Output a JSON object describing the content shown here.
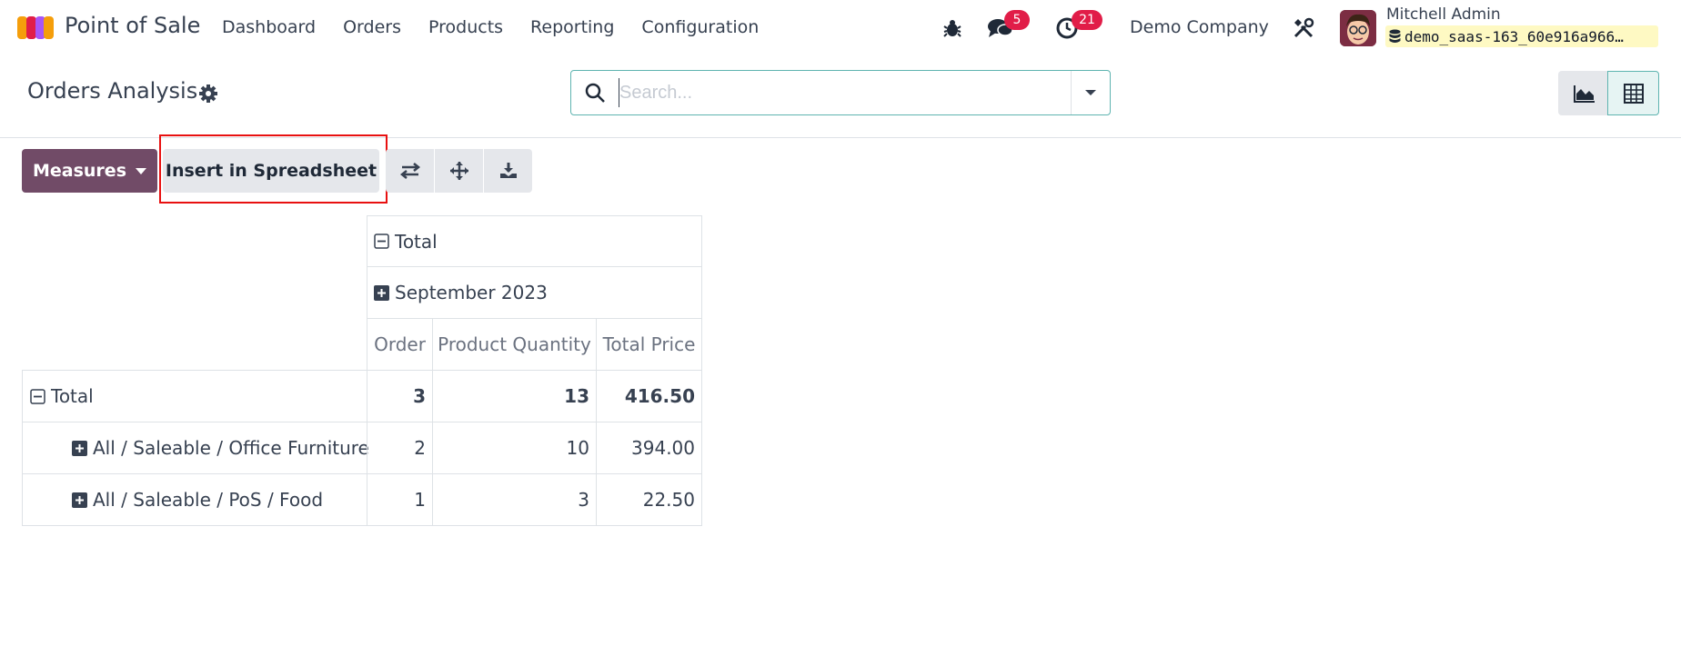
{
  "app": {
    "name": "Point of Sale"
  },
  "menu": [
    "Dashboard",
    "Orders",
    "Products",
    "Reporting",
    "Configuration"
  ],
  "systray": {
    "messages_count": "5",
    "activities_count": "21",
    "company": "Demo Company",
    "user_name": "Mitchell Admin",
    "database": "demo_saas-163_60e916a966…"
  },
  "control_panel": {
    "title": "Orders Analysis",
    "search_placeholder": "Search..."
  },
  "toolbar": {
    "measures_label": "Measures",
    "insert_label": "Insert in Spreadsheet"
  },
  "pivot": {
    "col_total": "Total",
    "col_group": "September 2023",
    "measures": [
      "Order",
      "Product Quantity",
      "Total Price"
    ],
    "rows": [
      {
        "label": "Total",
        "values": [
          "3",
          "13",
          "416.50"
        ]
      },
      {
        "label": "All / Saleable / Office Furniture",
        "values": [
          "2",
          "10",
          "394.00"
        ]
      },
      {
        "label": "All / Saleable / PoS / Food",
        "values": [
          "1",
          "3",
          "22.50"
        ]
      }
    ]
  },
  "colors": {
    "brand": "#714b67",
    "accent": "#5eb4b0",
    "badge": "#e11d48",
    "highlight": "#e81010"
  }
}
